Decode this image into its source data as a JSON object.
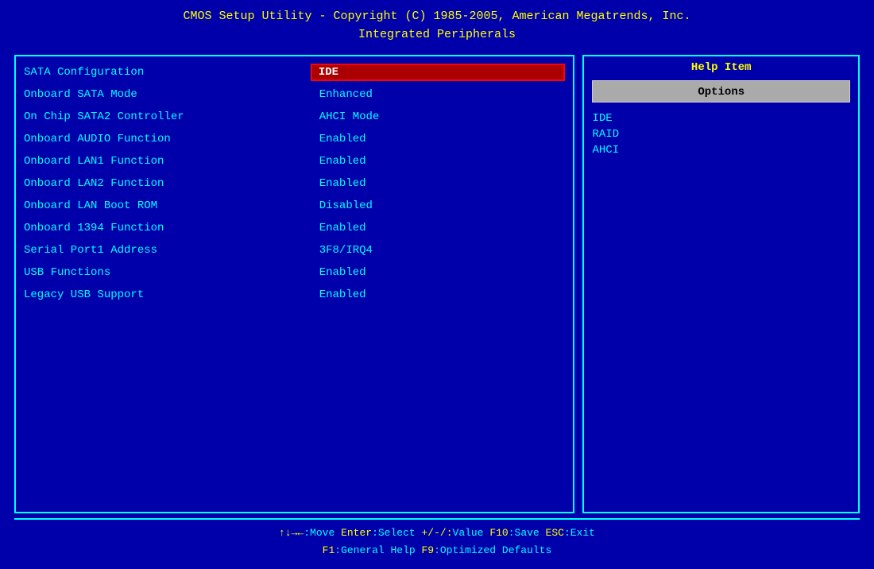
{
  "header": {
    "line1": "CMOS Setup Utility - Copyright (C) 1985-2005, American Megatrends, Inc.",
    "line2": "Integrated Peripherals"
  },
  "settings": [
    {
      "label": "SATA Configuration",
      "value": "IDE",
      "selected": true
    },
    {
      "label": "Onboard SATA Mode",
      "value": "Enhanced",
      "selected": false
    },
    {
      "label": "On Chip SATA2 Controller",
      "value": "AHCI Mode",
      "selected": false
    },
    {
      "label": "Onboard AUDIO Function",
      "value": "Enabled",
      "selected": false
    },
    {
      "label": "Onboard LAN1 Function",
      "value": "Enabled",
      "selected": false
    },
    {
      "label": "Onboard LAN2 Function",
      "value": "Enabled",
      "selected": false
    },
    {
      "label": "Onboard LAN Boot ROM",
      "value": "Disabled",
      "selected": false
    },
    {
      "label": "Onboard 1394 Function",
      "value": "Enabled",
      "selected": false
    },
    {
      "label": "Serial Port1 Address",
      "value": "3F8/IRQ4",
      "selected": false
    },
    {
      "label": "USB Functions",
      "value": "Enabled",
      "selected": false
    },
    {
      "label": "Legacy USB Support",
      "value": "Enabled",
      "selected": false
    }
  ],
  "help": {
    "title": "Help Item",
    "options_label": "Options",
    "options": [
      "IDE",
      "RAID",
      "AHCI"
    ]
  },
  "footer": {
    "line1_parts": [
      {
        "key": "↑↓→←",
        "desc": ":Move"
      },
      {
        "key": "Enter",
        "desc": ":Select"
      },
      {
        "key": "+/-/:",
        "desc": "Value"
      },
      {
        "key": "F10",
        "desc": ":Save"
      },
      {
        "key": "ESC",
        "desc": ":Exit"
      }
    ],
    "line2_parts": [
      {
        "key": "F1",
        "desc": ":General Help"
      },
      {
        "key": "F9",
        "desc": ":Optimized Defaults"
      }
    ]
  }
}
